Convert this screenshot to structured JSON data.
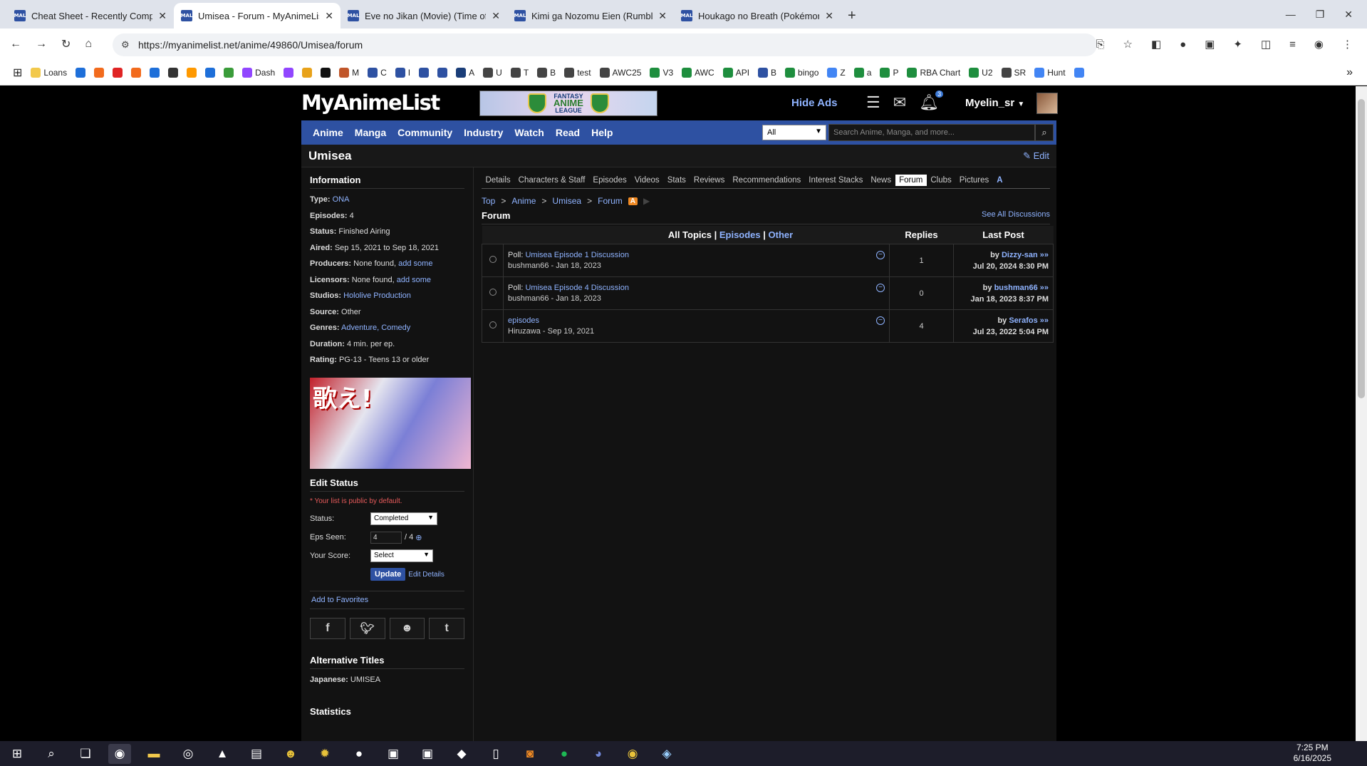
{
  "browser": {
    "tabs": [
      {
        "title": "Cheat Sheet - Recently Complet",
        "icon": "MAL"
      },
      {
        "title": "Umisea - Forum - MyAnimeList.",
        "icon": "MAL",
        "active": true
      },
      {
        "title": "Eve no Jikan (Movie) (Time of E",
        "icon": "MAL"
      },
      {
        "title": "Kimi ga Nozomu Eien (Rumblin",
        "icon": "MAL"
      },
      {
        "title": "Houkago no Breath (Pokémon",
        "icon": "MAL"
      }
    ],
    "url": "https://myanimelist.net/anime/49860/Umisea/forum",
    "bookmarks": [
      "Loans",
      "",
      "",
      "",
      "",
      "",
      "",
      "",
      "",
      "",
      "Dash",
      "",
      "",
      "",
      "M",
      "C",
      "I",
      "",
      "",
      "A",
      "U",
      "T",
      "B",
      "test",
      "AWC25",
      "V3",
      "AWC",
      "API",
      "B",
      "bingo",
      "Z",
      "a",
      "P",
      "RBA Chart",
      "U2",
      "SR",
      "Hunt",
      ""
    ]
  },
  "header": {
    "logo": "MyAnimeList",
    "banner_top": "FANTASY",
    "banner_main": "ANIME",
    "banner_bottom": "LEAGUE",
    "hide_ads": "Hide Ads",
    "notif_count": "3",
    "username": "Myelin_sr"
  },
  "nav": {
    "items": [
      "Anime",
      "Manga",
      "Community",
      "Industry",
      "Watch",
      "Read",
      "Help"
    ],
    "search_select": "All",
    "search_placeholder": "Search Anime, Manga, and more..."
  },
  "title": {
    "name": "Umisea",
    "edit": "Edit"
  },
  "info": {
    "heading": "Information",
    "rows": [
      {
        "label": "Type:",
        "value": "",
        "link": "ONA"
      },
      {
        "label": "Episodes:",
        "value": "4",
        "link": ""
      },
      {
        "label": "Status:",
        "value": "Finished Airing",
        "link": ""
      },
      {
        "label": "Aired:",
        "value": "Sep 15, 2021 to Sep 18, 2021",
        "link": ""
      },
      {
        "label": "Producers:",
        "value": "None found,",
        "link": "add some"
      },
      {
        "label": "Licensors:",
        "value": "None found,",
        "link": "add some"
      },
      {
        "label": "Studios:",
        "value": "",
        "link": "Hololive Production"
      },
      {
        "label": "Source:",
        "value": "Other",
        "link": ""
      },
      {
        "label": "Genres:",
        "value": "",
        "link": "Adventure, Comedy"
      },
      {
        "label": "Duration:",
        "value": "4 min. per ep.",
        "link": ""
      },
      {
        "label": "Rating:",
        "value": "PG-13 - Teens 13 or older",
        "link": ""
      }
    ],
    "cover_text": "歌え!"
  },
  "edit_status": {
    "heading": "Edit Status",
    "note": "* Your list is public by default.",
    "status_label": "Status:",
    "status_value": "Completed",
    "eps_label": "Eps Seen:",
    "eps_value": "4",
    "eps_total": "/ 4",
    "score_label": "Your Score:",
    "score_value": "Select",
    "update": "Update",
    "edit_details": "Edit Details",
    "add_fav": "Add to Favorites"
  },
  "alt_titles": {
    "heading": "Alternative Titles",
    "japanese_label": "Japanese:",
    "japanese": "UMISEA"
  },
  "statistics_heading": "Statistics",
  "subtabs": [
    "Details",
    "Characters & Staff",
    "Episodes",
    "Videos",
    "Stats",
    "Reviews",
    "Recommendations",
    "Interest Stacks",
    "News",
    "Forum",
    "Clubs",
    "Pictures"
  ],
  "breadcrumb": [
    "Top",
    "Anime",
    "Umisea",
    "Forum"
  ],
  "forum": {
    "heading": "Forum",
    "see_all": "See All Discussions",
    "filter_all": "All Topics",
    "filter_episodes": "Episodes",
    "filter_other": "Other",
    "col_replies": "Replies",
    "col_last": "Last Post",
    "topics": [
      {
        "prefix": "Poll:",
        "title": "Umisea Episode 1 Discussion",
        "meta": "bushman66 - Jan 18, 2023",
        "replies": "1",
        "by": "by",
        "last_user": "Dizzy-san »»",
        "last_date": "Jul 20, 2024 8:30 PM"
      },
      {
        "prefix": "Poll:",
        "title": "Umisea Episode 4 Discussion",
        "meta": "bushman66 - Jan 18, 2023",
        "replies": "0",
        "by": "by",
        "last_user": "bushman66 »»",
        "last_date": "Jan 18, 2023 8:37 PM"
      },
      {
        "prefix": "",
        "title": "episodes",
        "meta": "Hiruzawa - Sep 19, 2021",
        "replies": "4",
        "by": "by",
        "last_user": "Serafos »»",
        "last_date": "Jul 23, 2022 5:04 PM"
      }
    ]
  },
  "taskbar": {
    "time": "7:25 PM",
    "date": "6/16/2025"
  }
}
